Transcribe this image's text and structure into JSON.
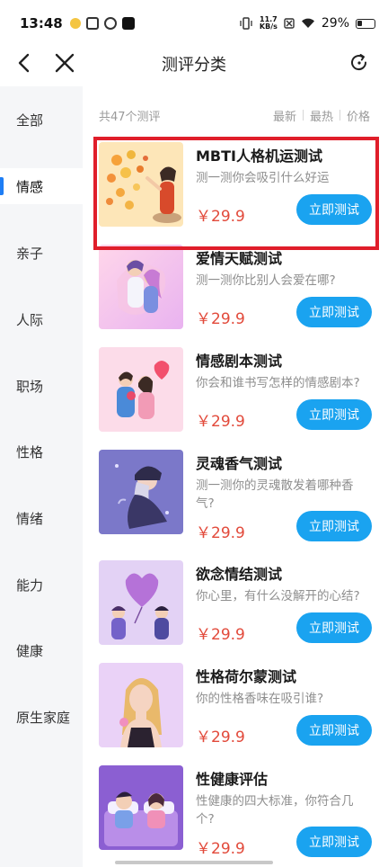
{
  "status": {
    "time": "13:48",
    "speed_value": "11.7",
    "speed_unit": "KB/s",
    "battery": "29%"
  },
  "nav": {
    "title": "测评分类"
  },
  "sidebar": {
    "items": [
      {
        "label": "全部"
      },
      {
        "label": "情感"
      },
      {
        "label": "亲子"
      },
      {
        "label": "人际"
      },
      {
        "label": "职场"
      },
      {
        "label": "性格"
      },
      {
        "label": "情绪"
      },
      {
        "label": "能力"
      },
      {
        "label": "健康"
      },
      {
        "label": "原生家庭"
      }
    ],
    "active_index": 1
  },
  "list": {
    "count_text": "共47个测评",
    "sort_options": [
      "最新",
      "最热",
      "价格"
    ]
  },
  "items": [
    {
      "title": "MBTI人格机运测试",
      "desc": "测一测你会吸引什么好运",
      "price": "￥29.9",
      "button": "立即测试"
    },
    {
      "title": "爱情天赋测试",
      "desc": "测一测你比别人会爱在哪?",
      "price": "￥29.9",
      "button": "立即测试"
    },
    {
      "title": "情感剧本测试",
      "desc": "你会和谁书写怎样的情感剧本?",
      "price": "￥29.9",
      "button": "立即测试"
    },
    {
      "title": "灵魂香气测试",
      "desc": "测一测你的灵魂散发着哪种香气?",
      "price": "￥29.9",
      "button": "立即测试"
    },
    {
      "title": "欲念情结测试",
      "desc": "你心里，有什么没解开的心结?",
      "price": "￥29.9",
      "button": "立即测试"
    },
    {
      "title": "性格荷尔蒙测试",
      "desc": "你的性格香味在吸引谁?",
      "price": "￥29.9",
      "button": "立即测试"
    },
    {
      "title": "性健康评估",
      "desc": "性健康的四大标准，你符合几个?",
      "price": "￥29.9",
      "button": "立即测试"
    }
  ]
}
